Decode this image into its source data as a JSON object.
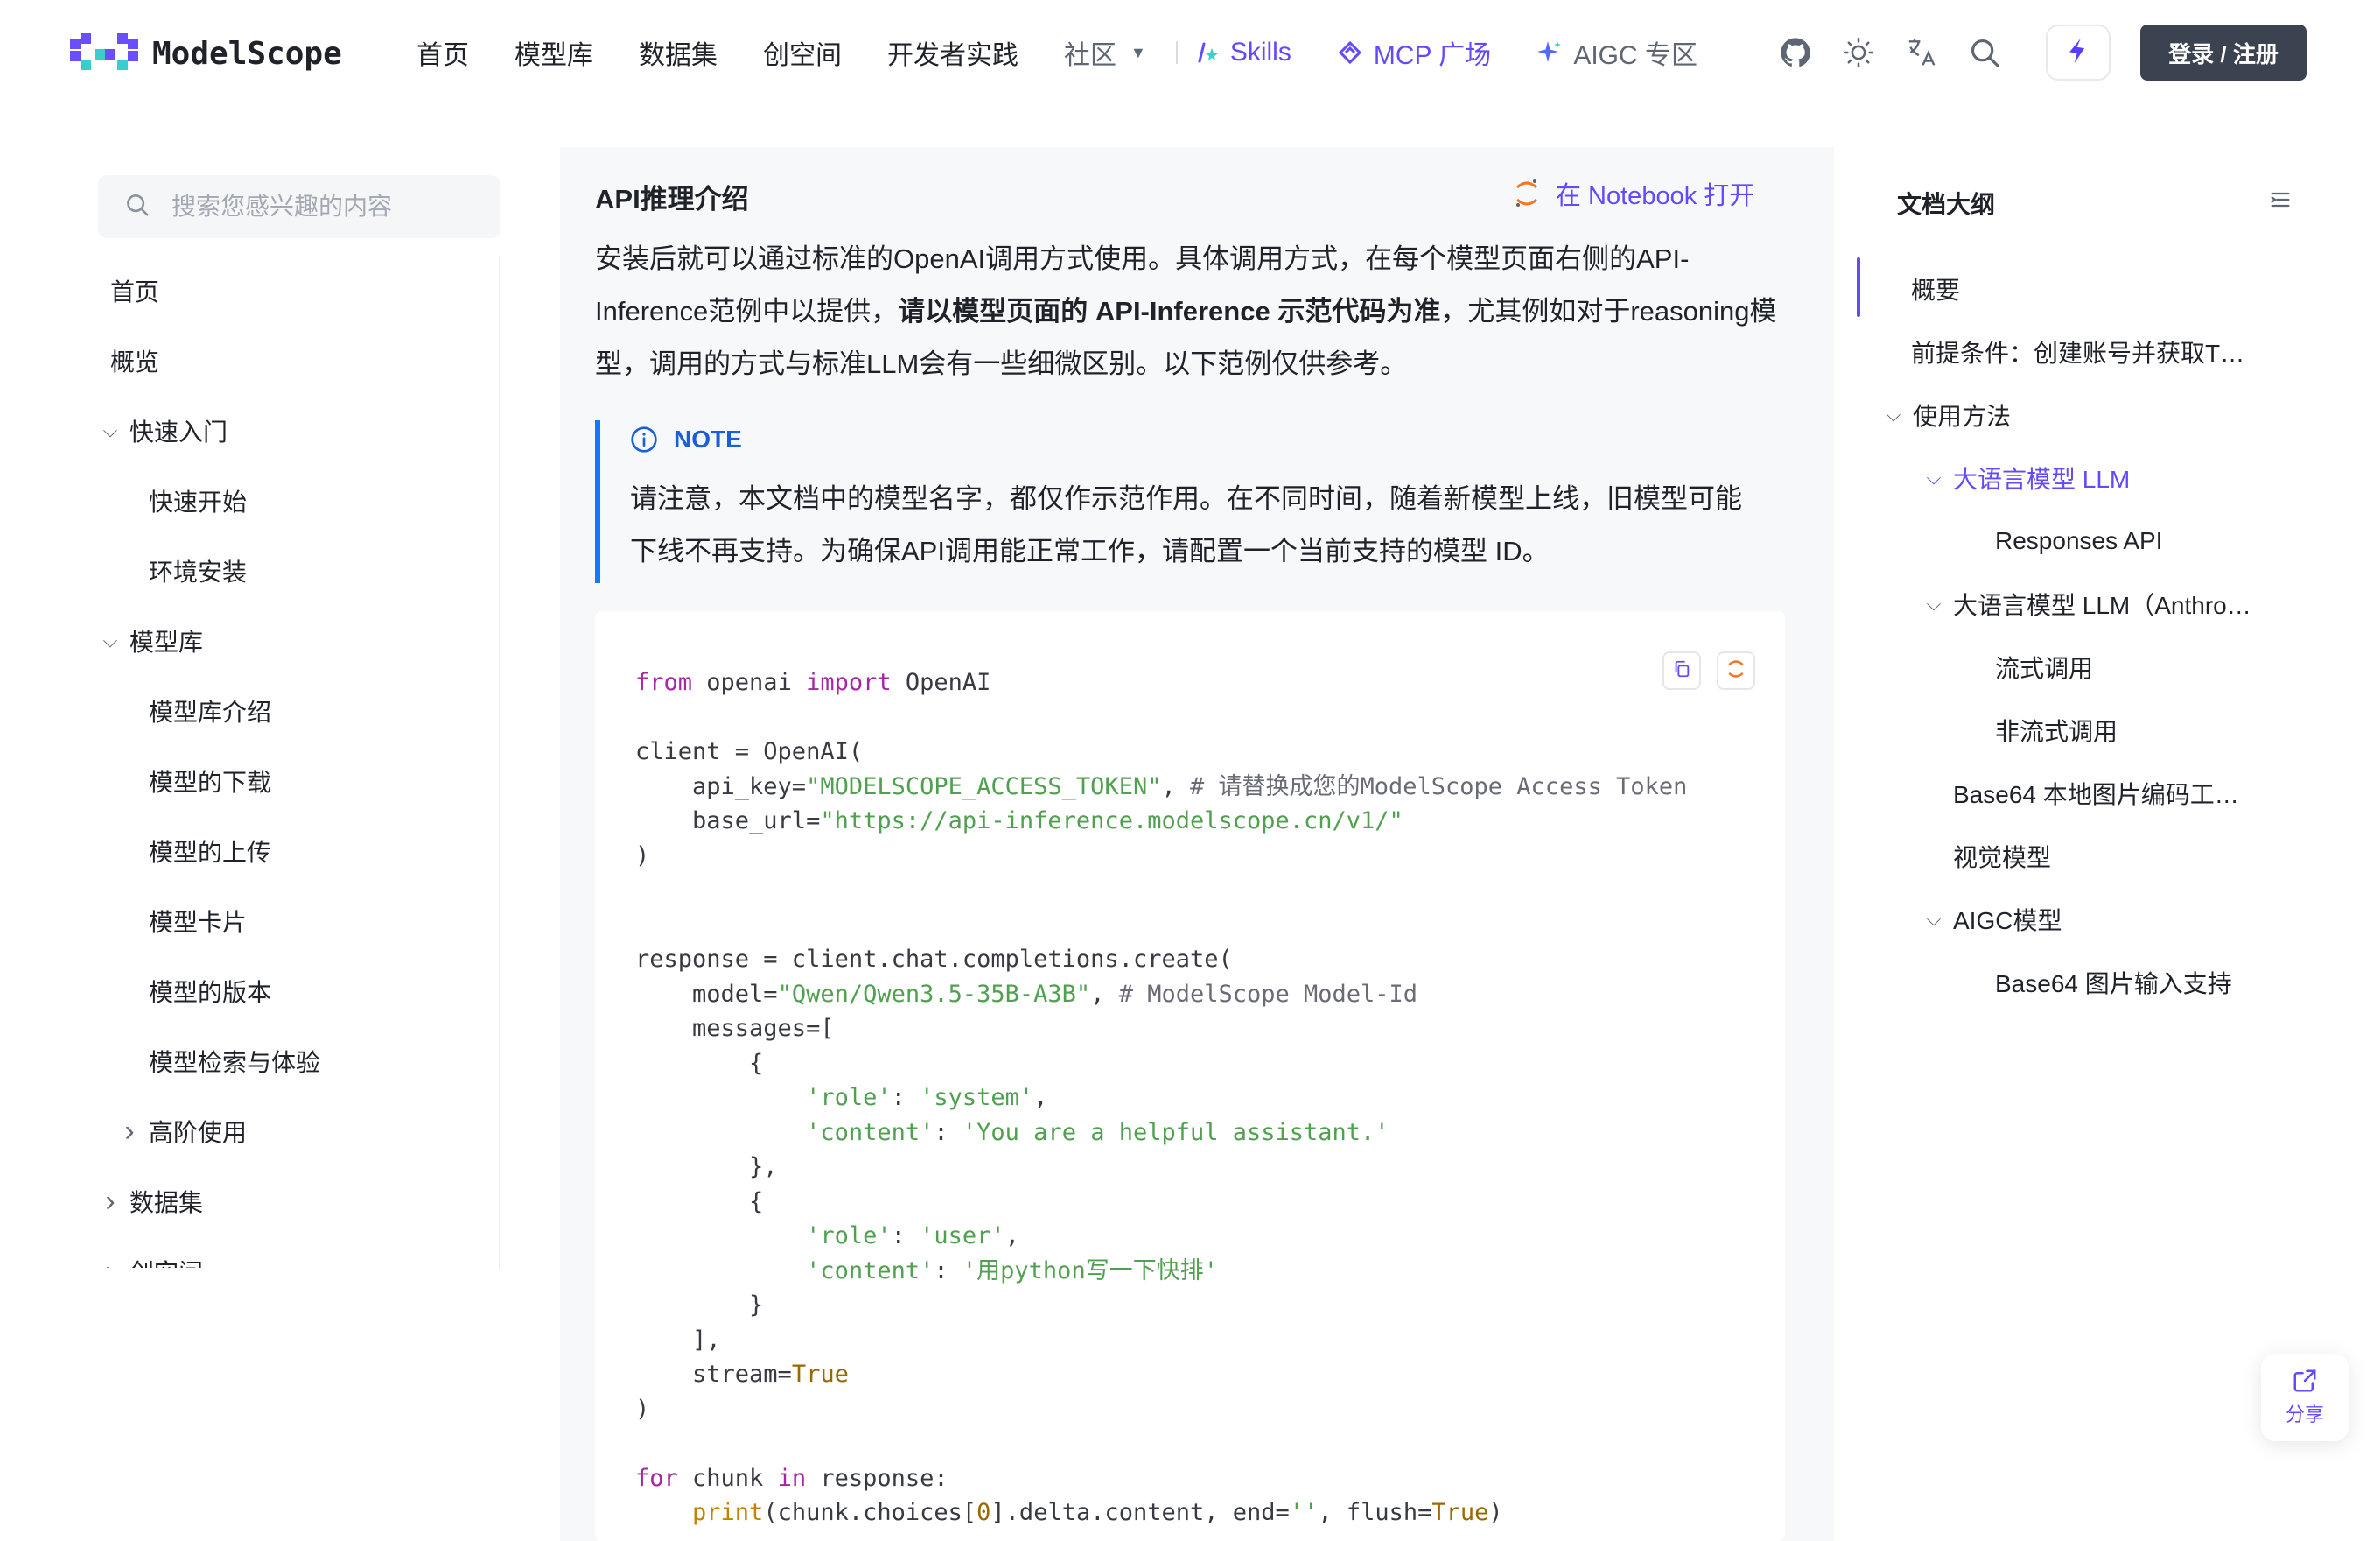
{
  "brand": {
    "name": "ModelScope",
    "accent": "#624aff"
  },
  "nav": {
    "items": [
      "首页",
      "模型库",
      "数据集",
      "创空间",
      "开发者实践"
    ],
    "community": "社区",
    "skills": "Skills",
    "mcp": "MCP 广场",
    "aigc": "AIGC 专区",
    "login": "登录 / 注册"
  },
  "sidebar": {
    "search_placeholder": "搜索您感兴趣的内容",
    "items": [
      {
        "label": "首页",
        "indent": 0,
        "chevron": ""
      },
      {
        "label": "概览",
        "indent": 0,
        "chevron": ""
      },
      {
        "label": "快速入门",
        "indent": 0,
        "chevron": "down"
      },
      {
        "label": "快速开始",
        "indent": 1,
        "chevron": ""
      },
      {
        "label": "环境安装",
        "indent": 1,
        "chevron": ""
      },
      {
        "label": "模型库",
        "indent": 0,
        "chevron": "down"
      },
      {
        "label": "模型库介绍",
        "indent": 1,
        "chevron": ""
      },
      {
        "label": "模型的下载",
        "indent": 1,
        "chevron": ""
      },
      {
        "label": "模型的上传",
        "indent": 1,
        "chevron": ""
      },
      {
        "label": "模型卡片",
        "indent": 1,
        "chevron": ""
      },
      {
        "label": "模型的版本",
        "indent": 1,
        "chevron": ""
      },
      {
        "label": "模型检索与体验",
        "indent": 1,
        "chevron": ""
      },
      {
        "label": "高阶使用",
        "indent": 1,
        "chevron": "right"
      },
      {
        "label": "数据集",
        "indent": 0,
        "chevron": "right"
      },
      {
        "label": "创空间",
        "indent": 0,
        "chevron": "right"
      }
    ]
  },
  "content": {
    "title": "API推理介绍",
    "notebook_link": "在 Notebook 打开",
    "para_part1": "安装后就可以通过标准的OpenAI调用方式使用。具体调用方式，在每个模型页面右侧的API-Inference范例中以提供，",
    "para_bold": "请以模型页面的 API-Inference 示范代码为准",
    "para_part2": "，尤其例如对于reasoning模型，调用的方式与标准LLM会有一些细微区别。以下范例仅供参考。",
    "note_label": "NOTE",
    "note_text": "请注意，本文档中的模型名字，都仅作示范作用。在不同时间，随着新模型上线，旧模型可能下线不再支持。为确保API调用能正常工作，请配置一个当前支持的模型 ID。",
    "code": {
      "l1": {
        "kw1": "from",
        "t1": " openai ",
        "kw2": "import",
        "t2": " OpenAI"
      },
      "l3": "client = OpenAI(",
      "l4": {
        "t1": "    api_key=",
        "s1": "\"MODELSCOPE_ACCESS_TOKEN\"",
        "t2": ", ",
        "c1": "# 请替换成您的ModelScope Access Token"
      },
      "l5": {
        "t1": "    base_url=",
        "s1": "\"https://api-inference.modelscope.cn/v1/\""
      },
      "l6": ")",
      "l9": "response = client.chat.completions.create(",
      "l10": {
        "t1": "    model=",
        "s1": "\"Qwen/Qwen3.5-35B-A3B\"",
        "t2": ", ",
        "c1": "# ModelScope Model-Id"
      },
      "l11": "    messages=[",
      "l12": "        {",
      "l13": {
        "t1": "            ",
        "s1": "'role'",
        "t2": ": ",
        "s2": "'system'",
        "t3": ","
      },
      "l14": {
        "t1": "            ",
        "s1": "'content'",
        "t2": ": ",
        "s2": "'You are a helpful assistant.'"
      },
      "l15": "        },",
      "l16": "        {",
      "l17": {
        "t1": "            ",
        "s1": "'role'",
        "t2": ": ",
        "s2": "'user'",
        "t3": ","
      },
      "l18": {
        "t1": "            ",
        "s1": "'content'",
        "t2": ": ",
        "s2": "'用python写一下快排'"
      },
      "l19": "        }",
      "l20": "    ],",
      "l21": {
        "t1": "    stream=",
        "k1": "True"
      },
      "l22": ")",
      "l24": {
        "kw1": "for",
        "t1": " chunk ",
        "kw2": "in",
        "t2": " response:"
      },
      "l25": {
        "t0": "    ",
        "f1": "print",
        "t1": "(chunk.choices[",
        "n1": "0",
        "t2": "].delta.content, end=",
        "s1": "''",
        "t3": ", flush=",
        "k1": "True",
        "t4": ")"
      }
    }
  },
  "toc": {
    "title": "文档大纲",
    "items": [
      {
        "label": "概要",
        "indent": 0,
        "chevron": "",
        "active": false
      },
      {
        "label": "前提条件：创建账号并获取T…",
        "indent": 0,
        "chevron": "",
        "active": false
      },
      {
        "label": "使用方法",
        "indent": 0,
        "chevron": "down",
        "active": false
      },
      {
        "label": "大语言模型 LLM",
        "indent": 1,
        "chevron": "down",
        "active": true
      },
      {
        "label": "Responses API",
        "indent": 2,
        "chevron": "",
        "active": false
      },
      {
        "label": "大语言模型 LLM（Anthro…",
        "indent": 1,
        "chevron": "down",
        "active": false
      },
      {
        "label": "流式调用",
        "indent": 2,
        "chevron": "",
        "active": false
      },
      {
        "label": "非流式调用",
        "indent": 2,
        "chevron": "",
        "active": false
      },
      {
        "label": "Base64 本地图片编码工…",
        "indent": 1,
        "chevron": "",
        "active": false
      },
      {
        "label": "视觉模型",
        "indent": 1,
        "chevron": "",
        "active": false
      },
      {
        "label": "AIGC模型",
        "indent": 1,
        "chevron": "down",
        "active": false
      },
      {
        "label": "Base64 图片输入支持",
        "indent": 2,
        "chevron": "",
        "active": false
      }
    ]
  },
  "share": {
    "label": "分享"
  },
  "icons": [
    "github-icon",
    "theme-toggle-icon",
    "language-icon",
    "search-icon",
    "ai-assistant-icon",
    "copy-icon",
    "notebook-icon",
    "info-icon",
    "share-icon"
  ]
}
